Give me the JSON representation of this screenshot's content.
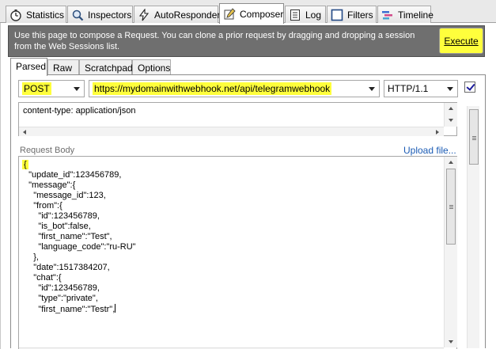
{
  "tabs": [
    {
      "label": "Statistics",
      "icon": "stopwatch-icon"
    },
    {
      "label": "Inspectors",
      "icon": "inspector-icon"
    },
    {
      "label": "AutoResponder",
      "icon": "lightning-icon"
    },
    {
      "label": "Composer",
      "icon": "pencil-icon"
    },
    {
      "label": "Log",
      "icon": "log-icon"
    },
    {
      "label": "Filters",
      "icon": "checkbox-icon"
    },
    {
      "label": "Timeline",
      "icon": "timeline-icon"
    }
  ],
  "active_tab": "Composer",
  "info": {
    "text": "Use this page to compose a Request. You can clone a prior request by dragging and dropping a session from the Web Sessions list.",
    "execute_label": "Execute"
  },
  "subtabs": [
    "Parsed",
    "Raw",
    "Scratchpad",
    "Options"
  ],
  "active_subtab": "Parsed",
  "request": {
    "method": "POST",
    "url": "https://mydomainwithwebhook.net/api/telegramwebhook",
    "version": "HTTP/1.1",
    "checked": true
  },
  "headers_text": "content-type: application/json",
  "body": {
    "label": "Request Body",
    "upload_label": "Upload file...",
    "lines": [
      "{",
      "  \"update_id\":123456789,",
      "  \"message\":{",
      "    \"message_id\":123,",
      "    \"from\":{",
      "      \"id\":123456789,",
      "      \"is_bot\":false,",
      "      \"first_name\":\"Test\",",
      "      \"language_code\":\"ru-RU\"",
      "    },",
      "    \"date\":1517384207,",
      "    \"chat\":{",
      "      \"id\":123456789,",
      "      \"type\":\"private\",",
      "      \"first_name\":\"Testr\","
    ]
  },
  "colors": {
    "highlight": "#ffff3c",
    "infobar": "#6f6f6f",
    "link": "#1a5bb4"
  }
}
